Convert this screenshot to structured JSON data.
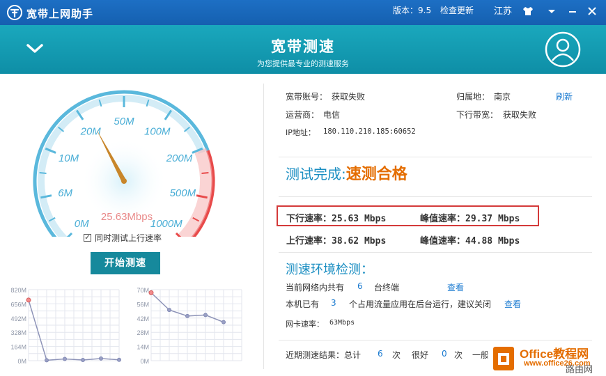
{
  "titlebar": {
    "app_name": "宽带上网助手",
    "version": "版本：9.5",
    "check_update": "检查更新",
    "region": "江苏"
  },
  "header": {
    "title": "宽带测速",
    "subtitle": "为您提供最专业的测速服务"
  },
  "gauge": {
    "labels": [
      "0M",
      "6M",
      "10M",
      "20M",
      "50M",
      "100M",
      "200M",
      "500M",
      "1000M"
    ],
    "current_reading": "25.63Mbps",
    "colors": {
      "arc": "#5ab8dc",
      "danger": "#e84a4a",
      "needle": "#c8862a"
    }
  },
  "options": {
    "upload_checkbox_label": "同时测试上行速率",
    "upload_checked": true,
    "start_button": "开始测速"
  },
  "charts": {
    "upload_axis": [
      "820M",
      "656M",
      "492M",
      "328M",
      "164M",
      "0M"
    ],
    "download_axis": [
      "70M",
      "56M",
      "42M",
      "28M",
      "14M",
      "0M"
    ]
  },
  "chart_data": [
    {
      "type": "line",
      "yticks": [
        "820M",
        "656M",
        "492M",
        "328M",
        "164M",
        "0M"
      ],
      "ylim": [
        0,
        820
      ],
      "values": [
        700,
        5,
        20,
        8,
        25,
        10
      ],
      "grid": true
    },
    {
      "type": "line",
      "yticks": [
        "70M",
        "56M",
        "42M",
        "28M",
        "14M",
        "0M"
      ],
      "ylim": [
        0,
        70
      ],
      "values": [
        67,
        50,
        44,
        45,
        38
      ],
      "grid": true
    }
  ],
  "info": {
    "account_label": "宽带账号：",
    "account_value": "获取失败",
    "location_label": "归属地：",
    "location_value": "南京",
    "refresh": "刷新",
    "isp_label": "运营商：",
    "isp_value": "电信",
    "bandwidth_label": "下行带宽：",
    "bandwidth_value": "获取失败",
    "ip_label": "IP地址：",
    "ip_value": "180.110.210.185:60652"
  },
  "result": {
    "done_text": "测试完成:",
    "status": "速测合格",
    "download_rate": "下行速率：25.63 Mbps",
    "download_peak": "峰值速率：29.37 Mbps",
    "upload_rate": "上行速率：38.62 Mbps",
    "upload_peak": "峰值速率：44.88 Mbps"
  },
  "environment": {
    "title": "测速环境检测：",
    "terminals_prefix": "当前网络内共有",
    "terminals_count": "6",
    "terminals_suffix": "台终端",
    "view1": "查看",
    "apps_prefix": "本机已有",
    "apps_count": "3",
    "apps_suffix": "个占用流量应用在后台运行，建议关闭",
    "view2": "查看",
    "nic_label": "网卡速率：",
    "nic_value": "63Mbps"
  },
  "history": {
    "label": "近期测速结果：总计",
    "total": "6",
    "times1": "次",
    "good_label": "很好",
    "good_count": "0",
    "times2": "次",
    "normal_label": "一般"
  },
  "watermark": {
    "brand": "Office教程网",
    "url": "www.office26.com",
    "mark": "路由网"
  }
}
